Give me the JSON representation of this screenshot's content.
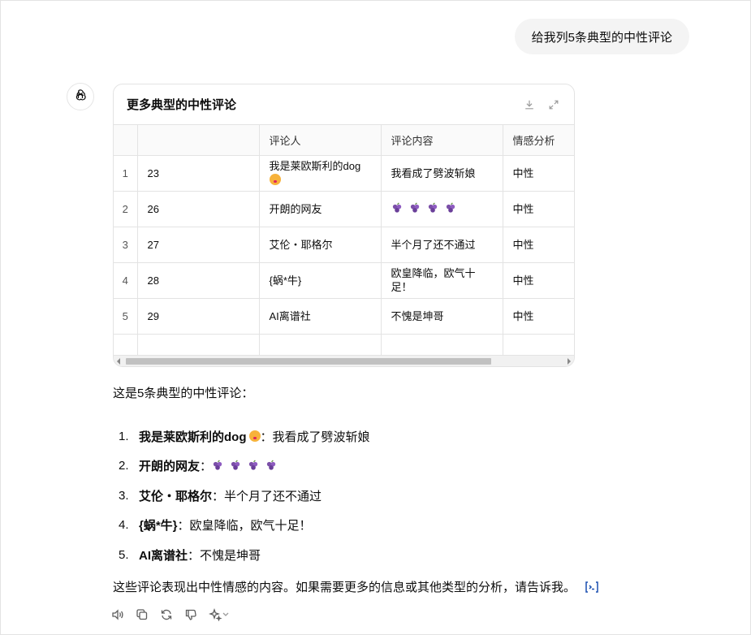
{
  "user_message": "给我列5条典型的中性评论",
  "table_card": {
    "title": "更多典型的中性评论",
    "columns": [
      "",
      "评论人",
      "评论内容",
      "情感分析"
    ],
    "rows": [
      {
        "n": "1",
        "id": "23",
        "reviewer": "我是莱欧斯利的dog",
        "reviewer_emoji": "kiss",
        "content": "我看成了劈波斩娘",
        "sentiment": "中性"
      },
      {
        "n": "2",
        "id": "26",
        "reviewer": "开朗的网友",
        "content": "",
        "content_emoji": "grapes-x4",
        "sentiment": "中性"
      },
      {
        "n": "3",
        "id": "27",
        "reviewer": "艾伦・耶格尔",
        "content": "半个月了还不通过",
        "sentiment": "中性"
      },
      {
        "n": "4",
        "id": "28",
        "reviewer": "{蜗*牛}",
        "content": "欧皇降临，欧气十足！",
        "sentiment": "中性"
      },
      {
        "n": "5",
        "id": "29",
        "reviewer": "AI离谱社",
        "content": "不愧是坤哥",
        "sentiment": "中性"
      }
    ]
  },
  "intro": "这是5条典型的中性评论：",
  "summary": [
    {
      "num": "1.",
      "name": "我是莱欧斯利的dog",
      "text": "：我看成了劈波斩娘"
    },
    {
      "num": "2.",
      "name": "开朗的网友",
      "text": "："
    },
    {
      "num": "3.",
      "name": "艾伦・耶格尔",
      "text": "：半个月了还不通过"
    },
    {
      "num": "4.",
      "name": "{蜗*牛}",
      "text": "：欧皇降临，欧气十足！"
    },
    {
      "num": "5.",
      "name": "AI离谱社",
      "text": "：不愧是坤哥"
    }
  ],
  "closing": "这些评论表现出中性情感的内容。如果需要更多的信息或其他类型的分析，请告诉我。",
  "icons": {
    "avatar": "openai-logo-icon",
    "download": "download-icon",
    "expand": "expand-icon",
    "cite": "code-interpreter-icon",
    "toolbar": [
      "read-aloud-icon",
      "copy-icon",
      "regenerate-icon",
      "thumbs-down-icon",
      "sparkle-model-icon"
    ]
  },
  "colors": {
    "accent": "#1a4fb0",
    "grape": "#7b4fa8"
  }
}
